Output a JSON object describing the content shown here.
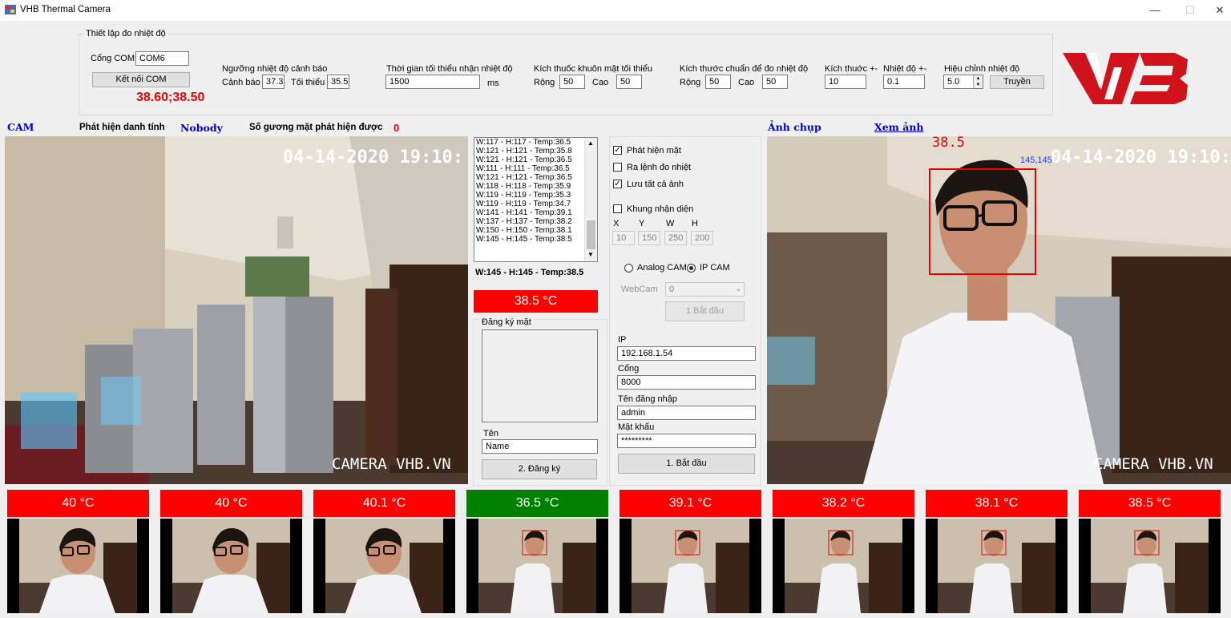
{
  "window": {
    "title": "VHB Thermal Camera",
    "minimize": "—",
    "maximize": "☐",
    "close": "✕"
  },
  "settings": {
    "group_title": "Thiết lập đo nhiệt độ",
    "com_label": "Cổng COM",
    "com_value": "COM6",
    "connect_label": "Kết nối COM",
    "reading": "38.60;38.50",
    "threshold_title": "Ngưỡng nhiệt độ cảnh báo",
    "warn_label": "Cảnh báo",
    "warn_value": "37.3",
    "min_label": "Tối thiểu",
    "min_value": "35.5",
    "time_title": "Thời gian tối thiểu nhận nhiệt độ",
    "time_value": "1500",
    "time_unit": "ms",
    "face_title": "Kích thuốc khuôn mặt tối thiểu",
    "face_w_label": "Rộng",
    "face_w": "50",
    "face_h_label": "Cao",
    "face_h": "50",
    "std_title": "Kích thước chuẩn để đo nhiệt độ",
    "std_w_label": "Rộng",
    "std_w": "50",
    "std_h_label": "Cao",
    "std_h": "50",
    "size_title": "Kích thuớc +-",
    "size_value": "10",
    "temp_title": "Nhiệt độ +-",
    "temp_value": "0.1",
    "adjust_title": "Hiệu chỉnh nhiệt độ",
    "adjust_value": "5.0",
    "send_label": "Truyền"
  },
  "logo": {
    "text": "VHB",
    "color": "#d0121b"
  },
  "status": {
    "cam_label": "CAM",
    "identity_label": "Phát hiện danh tính",
    "identity_value": "Nobody",
    "faces_label": "Số gương mặt phát hiện được",
    "faces_value": "0",
    "snapshot_label": "Ảnh chụp",
    "view_link": "Xem ảnh"
  },
  "live_cam": {
    "timestamp": "04-14-2020 19:10:",
    "watermark": "CAMERA VHB.VN"
  },
  "snap_cam": {
    "timestamp": "04-14-2020 19:10:",
    "watermark": "CAMERA VHB.VN",
    "box_label": "145,145",
    "temp_overlay": "38.5"
  },
  "log": {
    "lines": [
      "W:117 - H:117 - Temp:36.5",
      "W:121 - H:121 - Temp:35.8",
      "W:121 - H:121 - Temp:36.5",
      "W:111 - H:111 - Temp:36.5",
      "W:121 - H:121 - Temp:36.5",
      "W:118 - H:118 - Temp:35.9",
      "W:119 - H:119 - Temp:35.3",
      "W:119 - H:119 - Temp:34.7",
      "W:141 - H:141 - Temp:39.1",
      "W:137 - H:137 - Temp:38.2",
      "W:150 - H:150 - Temp:38.1",
      "W:145 - H:145 - Temp:38.5"
    ],
    "current": "W:145 - H:145 - Temp:38.5",
    "temp_display": "38.5 °C"
  },
  "register": {
    "title": "Đăng ký mặt",
    "name_label": "Tên",
    "name_value": "Name",
    "button": "2. Đăng ký"
  },
  "options": {
    "detect_face": {
      "label": "Phát hiện mặt",
      "checked": true
    },
    "measure_cmd": {
      "label": "Ra lệnh đo nhiệt",
      "checked": false
    },
    "save_all": {
      "label": "Lưu tất cả ảnh",
      "checked": true
    },
    "frame": {
      "label": "Khung nhận diện",
      "checked": false
    },
    "x_label": "X",
    "y_label": "Y",
    "w_label": "W",
    "h_label": "H",
    "x": "10",
    "y": "150",
    "w": "250",
    "h": "200",
    "analog_label": "Analog CAM",
    "ipcam_label": "IP CAM",
    "webcam_label": "WebCam",
    "webcam_value": "0",
    "start1_label": "1.Bắt đầu"
  },
  "ipcam": {
    "ip_label": "IP",
    "ip_value": "192.168.1.54",
    "port_label": "Cổng",
    "port_value": "8000",
    "user_label": "Tên đăng nhập",
    "user_value": "admin",
    "pass_label": "Mật khẩu",
    "pass_value": "*********",
    "start_label": "1. Bắt đầu"
  },
  "history": [
    {
      "temp": "40 °C",
      "color": "#ff0000"
    },
    {
      "temp": "40 °C",
      "color": "#ff0000"
    },
    {
      "temp": "40.1 °C",
      "color": "#ff0000"
    },
    {
      "temp": "36.5 °C",
      "color": "#008000"
    },
    {
      "temp": "39.1 °C",
      "color": "#ff0000"
    },
    {
      "temp": "38.2 °C",
      "color": "#ff0000"
    },
    {
      "temp": "38.1 °C",
      "color": "#ff0000"
    },
    {
      "temp": "38.5 °C",
      "color": "#ff0000"
    }
  ]
}
